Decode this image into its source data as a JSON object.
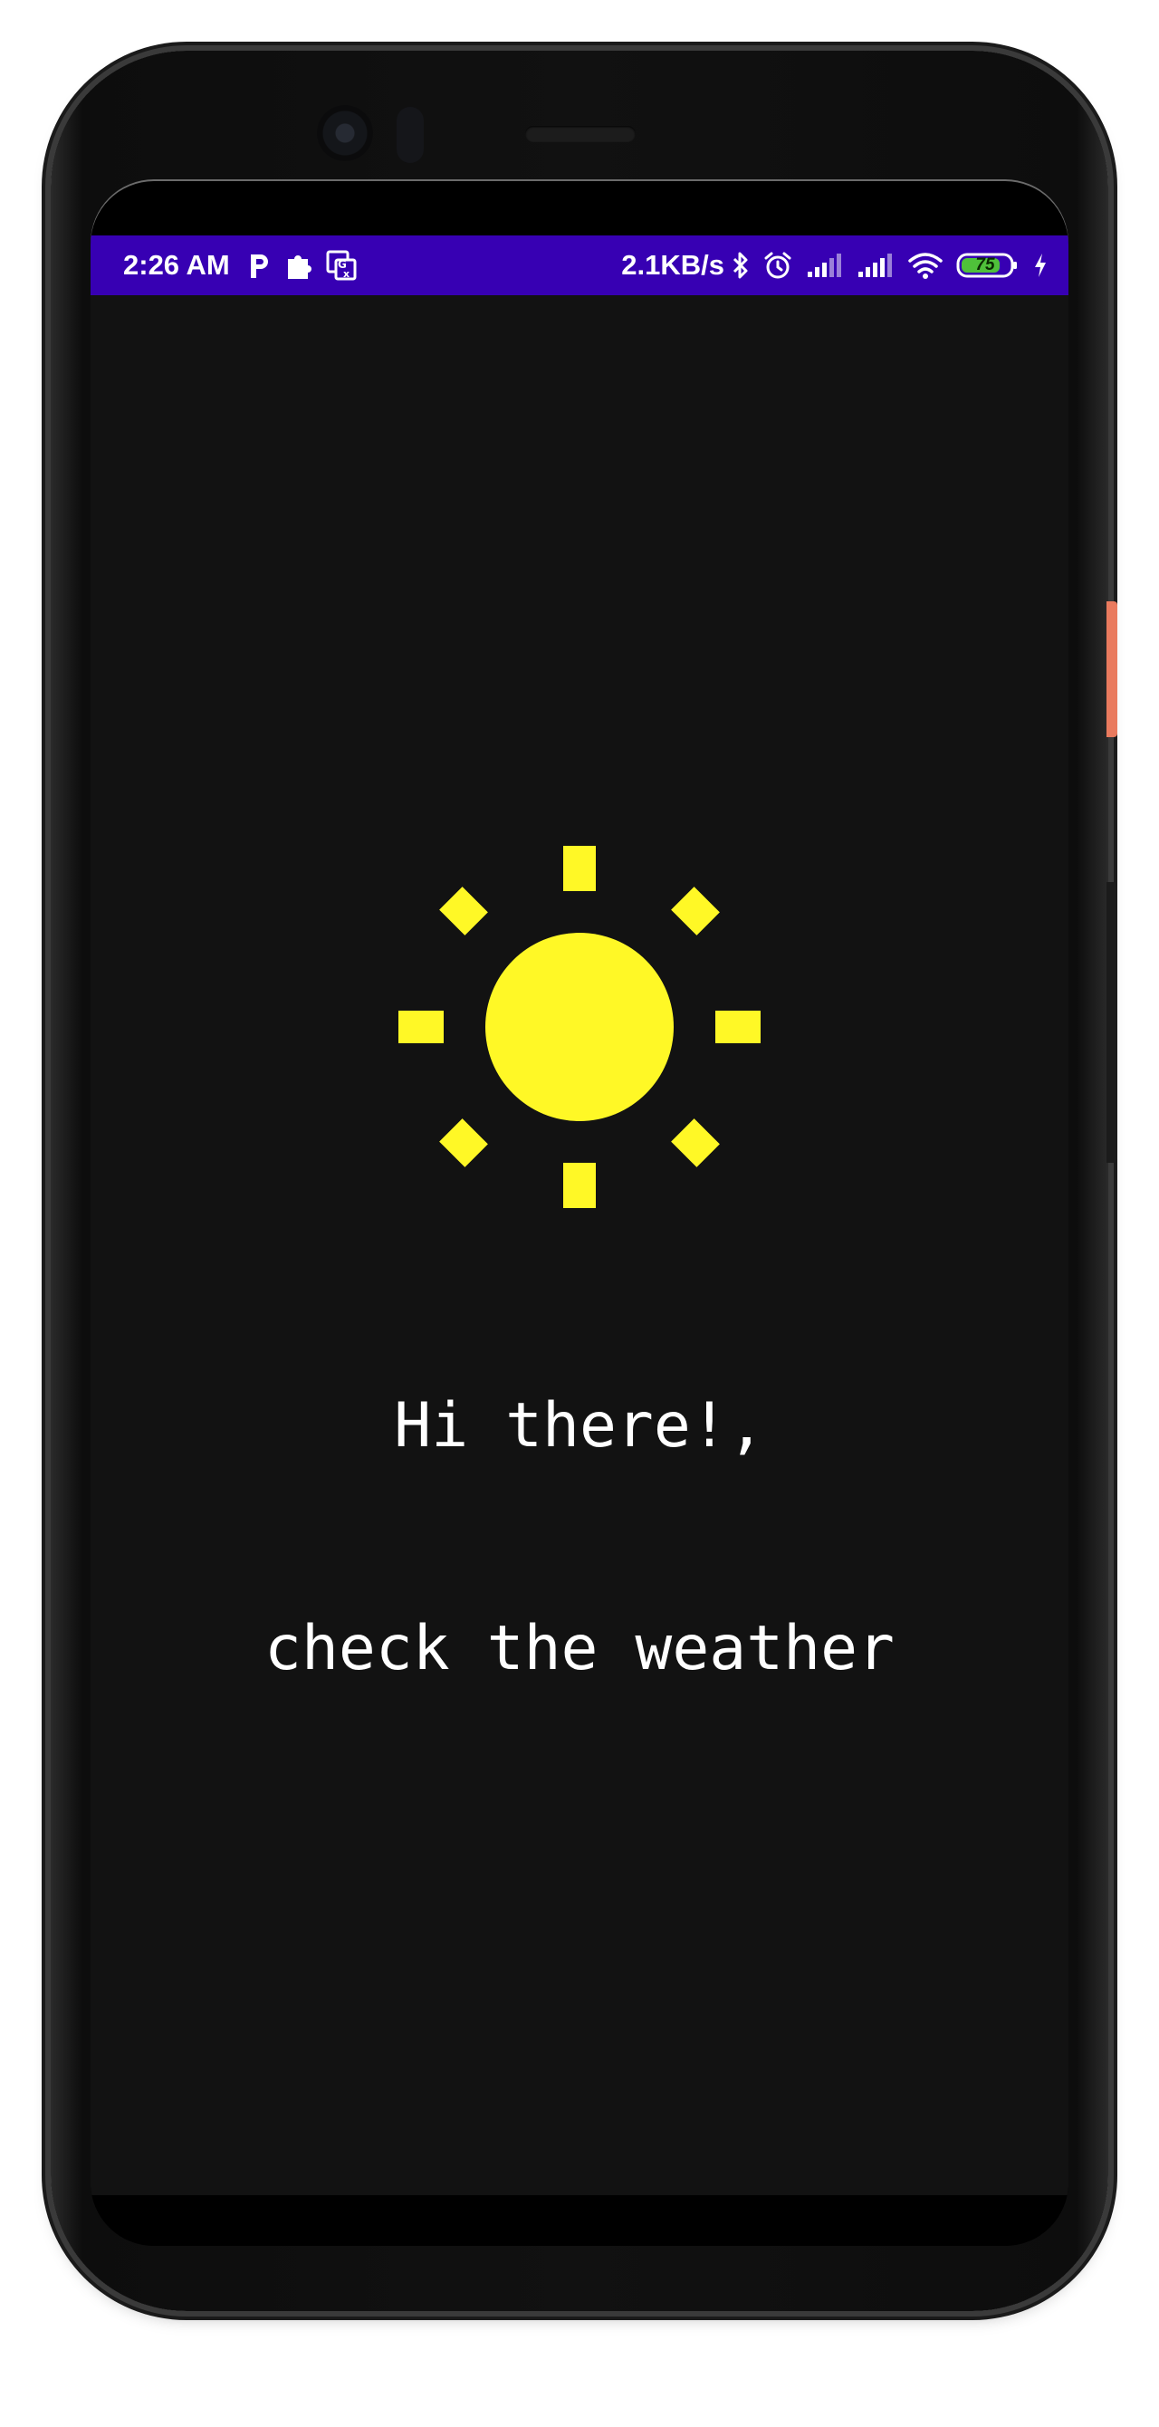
{
  "status_bar": {
    "time": "2:26 AM",
    "network_speed": "2.1KB/s",
    "battery_level": "75",
    "background_color": "#3700b3",
    "left_icons": [
      "p-notification-icon",
      "puzzle-icon",
      "translate-icon"
    ],
    "right_icons": [
      "bluetooth-icon",
      "alarm-icon",
      "signal-icon",
      "signal-icon",
      "wifi-icon",
      "battery-icon",
      "charging-icon"
    ]
  },
  "main": {
    "weather_icon": "sun-icon",
    "sun_color": "#fff826",
    "greeting_line1": "Hi there!,",
    "greeting_line2": "check the weather",
    "background_color": "#121212"
  }
}
